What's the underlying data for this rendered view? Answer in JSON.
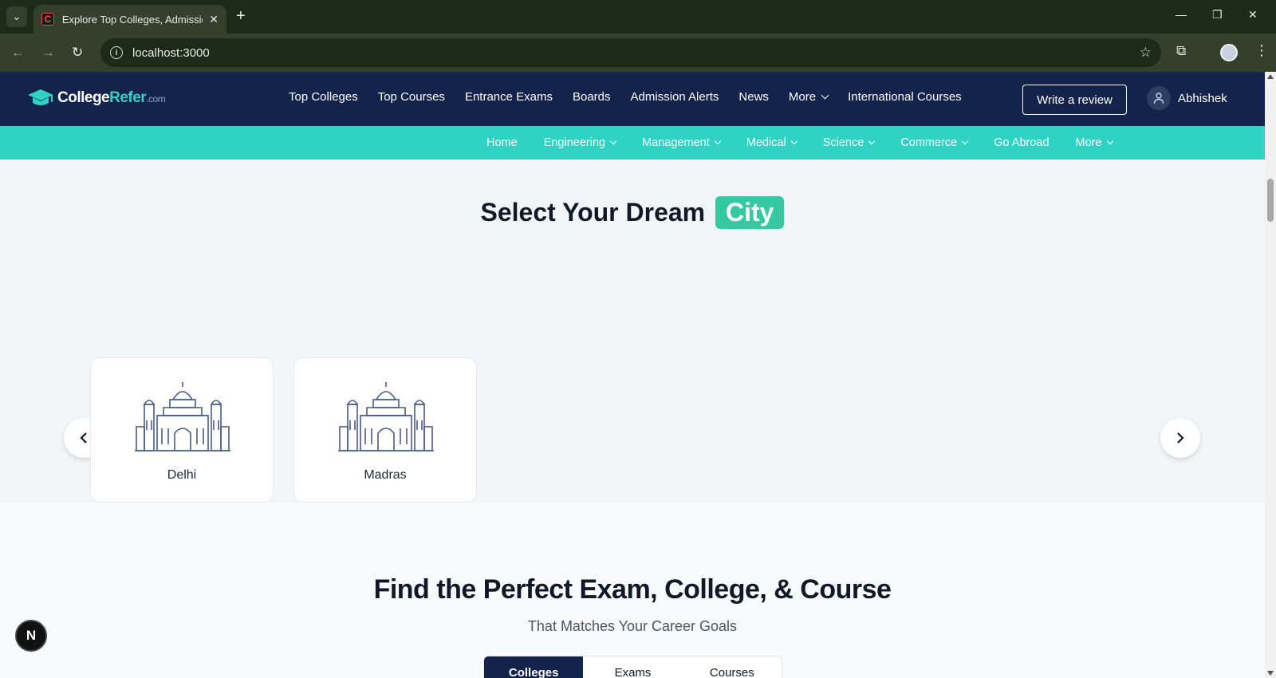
{
  "browser": {
    "tab_title": "Explore Top Colleges, Admissions",
    "favicon_letter": "C",
    "url": "localhost:3000"
  },
  "header": {
    "logo": {
      "name": "CollegeRefer",
      "name_main": "College",
      "name_accent": "Refer",
      "suffix": ".com"
    },
    "nav": [
      {
        "label": "Top Colleges",
        "has_dropdown": false
      },
      {
        "label": "Top Courses",
        "has_dropdown": false
      },
      {
        "label": "Entrance Exams",
        "has_dropdown": false
      },
      {
        "label": "Boards",
        "has_dropdown": false
      },
      {
        "label": "Admission Alerts",
        "has_dropdown": false
      },
      {
        "label": "News",
        "has_dropdown": false
      },
      {
        "label": "More",
        "has_dropdown": true
      },
      {
        "label": "International Courses",
        "has_dropdown": false
      }
    ],
    "write_review": "Write a review",
    "user_name": "Abhishek"
  },
  "subnav": [
    {
      "label": "Home",
      "has_dropdown": false
    },
    {
      "label": "Engineering",
      "has_dropdown": true
    },
    {
      "label": "Management",
      "has_dropdown": true
    },
    {
      "label": "Medical",
      "has_dropdown": true
    },
    {
      "label": "Science",
      "has_dropdown": true
    },
    {
      "label": "Commerce",
      "has_dropdown": true
    },
    {
      "label": "Go Abroad",
      "has_dropdown": false
    },
    {
      "label": "More",
      "has_dropdown": true
    }
  ],
  "city_section": {
    "heading_prefix": "Select Your Dream",
    "heading_highlight": "City",
    "cities": [
      {
        "name": "Delhi",
        "icon": "monument-icon"
      },
      {
        "name": "Madras",
        "icon": "monument-icon"
      }
    ],
    "prev_icon": "chevron-left-icon",
    "next_icon": "chevron-right-icon"
  },
  "find_section": {
    "title": "Find the Perfect Exam, College, & Course",
    "subtitle": "That Matches Your Career Goals",
    "tabs": [
      {
        "label": "Colleges",
        "active": true
      },
      {
        "label": "Exams",
        "active": false
      },
      {
        "label": "Courses",
        "active": false
      }
    ]
  },
  "dev_badge": "N",
  "colors": {
    "navy": "#14234b",
    "teal": "#2ed3c3",
    "accent_green": "#34c9a0",
    "page_bg": "#f3f6f9"
  }
}
